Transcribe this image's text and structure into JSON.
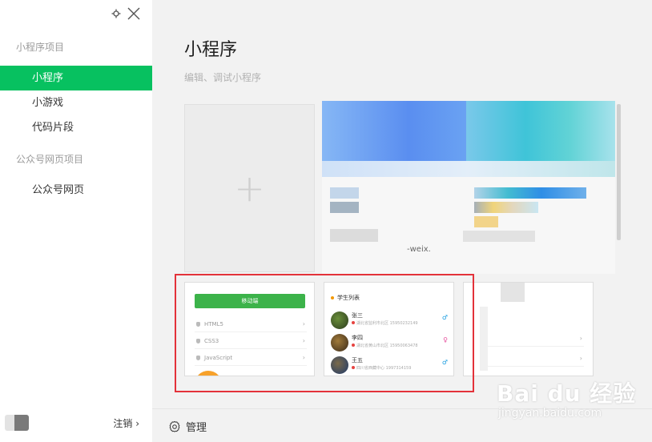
{
  "sidebar": {
    "section1_title": "小程序项目",
    "items": [
      {
        "label": "小程序"
      },
      {
        "label": "小游戏"
      },
      {
        "label": "代码片段"
      }
    ],
    "section2_title": "公众号网页项目",
    "items2": [
      {
        "label": "公众号网页"
      }
    ],
    "logout_label": "注销",
    "logout_chevron": "›"
  },
  "main": {
    "title": "小程序",
    "subtitle": "编辑、调试小程序",
    "add_symbol": "+",
    "manage_label": "管理"
  },
  "preview1": {
    "button_label": "移动端",
    "rows": [
      {
        "label": "HTML5"
      },
      {
        "label": "CSS3"
      },
      {
        "label": "JavaScript"
      }
    ],
    "arrow": "›"
  },
  "preview2": {
    "title": "学生列表",
    "students": [
      {
        "name": "张三",
        "info": "湖北省监利市北区 15950232149",
        "sex": "♂"
      },
      {
        "name": "李四",
        "info": "湖北省黄山市北区 15950063478",
        "sex": "♀"
      },
      {
        "name": "王五",
        "info": "四川省西藏中心 1997314159",
        "sex": "♂"
      }
    ]
  },
  "blurred": {
    "fragment": "-weix."
  },
  "watermark": {
    "main": "Bai du 经验",
    "sub": "jingyan.baidu.com"
  },
  "colors": {
    "accent": "#07c160",
    "highlight": "#e3323a"
  }
}
